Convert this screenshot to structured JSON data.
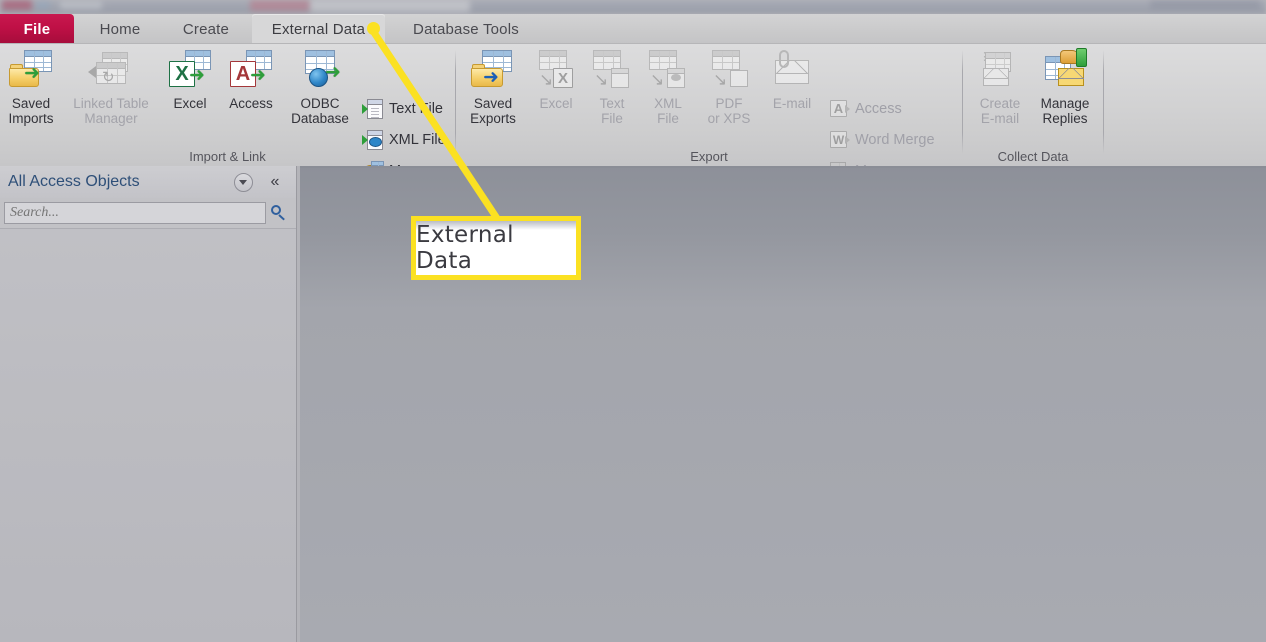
{
  "window": {
    "title_bar_visible": true
  },
  "tabs": [
    {
      "id": "file",
      "label": "File"
    },
    {
      "id": "home",
      "label": "Home"
    },
    {
      "id": "create",
      "label": "Create"
    },
    {
      "id": "external",
      "label": "External Data"
    },
    {
      "id": "dbtools",
      "label": "Database Tools"
    }
  ],
  "active_tab": "External Data",
  "ribbon": {
    "groups": [
      {
        "id": "import-link",
        "label": "Import & Link",
        "big_buttons": [
          {
            "id": "saved-imports",
            "line1": "Saved",
            "line2": "Imports",
            "icon": "saved-imports-icon",
            "disabled": false
          },
          {
            "id": "linked-table-manager",
            "line1": "Linked Table",
            "line2": "Manager",
            "icon": "linked-table-manager-icon",
            "disabled": true
          },
          {
            "id": "excel-import",
            "line1": "Excel",
            "line2": "",
            "icon": "excel-import-icon",
            "disabled": false
          },
          {
            "id": "access-import",
            "line1": "Access",
            "line2": "",
            "icon": "access-import-icon",
            "disabled": false
          },
          {
            "id": "odbc-database",
            "line1": "ODBC",
            "line2": "Database",
            "icon": "odbc-database-icon",
            "disabled": false
          }
        ],
        "small_buttons": [
          {
            "id": "text-file-import",
            "label": "Text File",
            "icon": "text-file-icon",
            "disabled": false,
            "caret": false
          },
          {
            "id": "xml-file-import",
            "label": "XML File",
            "icon": "xml-file-icon",
            "disabled": false,
            "caret": false
          },
          {
            "id": "more-import",
            "label": "More",
            "icon": "more-import-icon",
            "disabled": false,
            "caret": false
          }
        ]
      },
      {
        "id": "export",
        "label": "Export",
        "big_buttons": [
          {
            "id": "saved-exports",
            "line1": "Saved",
            "line2": "Exports",
            "icon": "saved-exports-icon",
            "disabled": false
          },
          {
            "id": "excel-export",
            "line1": "Excel",
            "line2": "",
            "icon": "excel-export-icon",
            "disabled": true
          },
          {
            "id": "text-export",
            "line1": "Text",
            "line2": "File",
            "icon": "text-export-icon",
            "disabled": true
          },
          {
            "id": "xml-export",
            "line1": "XML",
            "line2": "File",
            "icon": "xml-export-icon",
            "disabled": true
          },
          {
            "id": "pdf-export",
            "line1": "PDF",
            "line2": "or XPS",
            "icon": "pdf-export-icon",
            "disabled": true
          },
          {
            "id": "email-export",
            "line1": "E-mail",
            "line2": "",
            "icon": "email-icon",
            "disabled": true
          }
        ],
        "small_buttons": [
          {
            "id": "access-export",
            "label": "Access",
            "icon": "access-small-icon",
            "disabled": true,
            "caret": false
          },
          {
            "id": "word-merge",
            "label": "Word Merge",
            "icon": "word-merge-icon",
            "disabled": true,
            "caret": false
          },
          {
            "id": "more-export",
            "label": "More",
            "icon": "more-export-icon",
            "disabled": true,
            "caret": true
          }
        ]
      },
      {
        "id": "collect-data",
        "label": "Collect Data",
        "big_buttons": [
          {
            "id": "create-email",
            "line1": "Create",
            "line2": "E-mail",
            "icon": "create-email-icon",
            "disabled": true
          },
          {
            "id": "manage-replies",
            "line1": "Manage",
            "line2": "Replies",
            "icon": "manage-replies-icon",
            "disabled": false
          }
        ],
        "small_buttons": []
      }
    ]
  },
  "nav_pane": {
    "title": "All Access Objects",
    "dropdown_icon": "chevron-down-icon",
    "collapse_icon": "double-chevron-left-icon",
    "search": {
      "value": "",
      "placeholder": "Search...",
      "icon": "search-icon"
    }
  },
  "annotation": {
    "callout_text": "External Data",
    "highlight_color": "#fbe122",
    "target_tab": "External Data"
  }
}
